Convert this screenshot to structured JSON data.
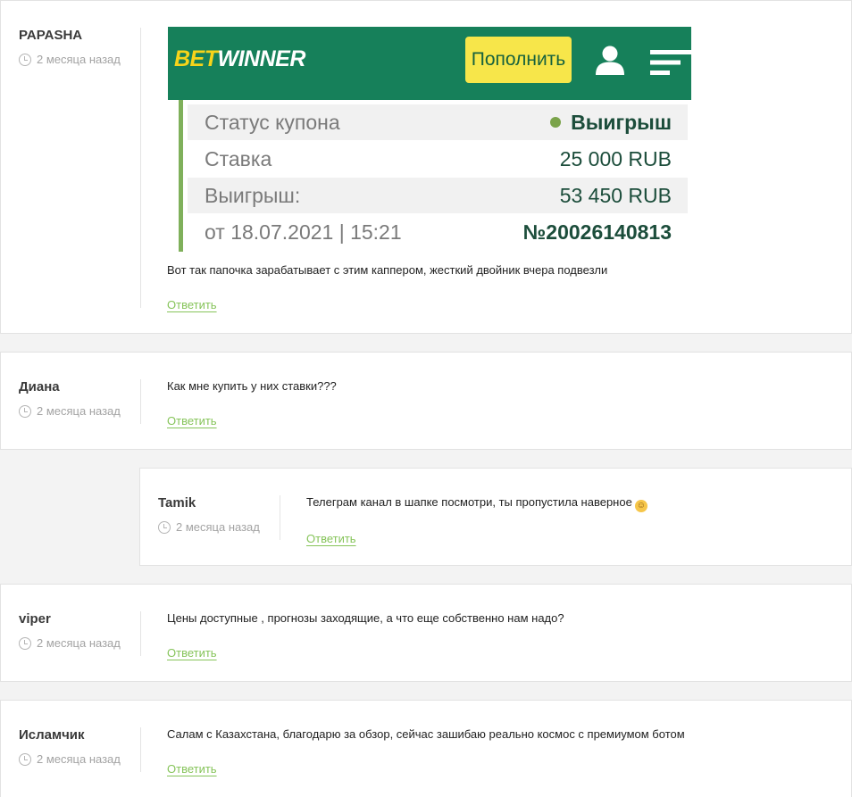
{
  "comments": [
    {
      "author": "PAPASHA",
      "time": "2 месяца назад",
      "text": "Вот так папочка зарабатывает с этим каппером, жесткий двойник вчера подвезли",
      "reply": "Ответить",
      "screenshot": {
        "logo_bet": "BET",
        "logo_winner": "WINNER",
        "deposit_button": "Пополнить",
        "rows": [
          {
            "label": "Статус купона",
            "value": "Выигрыш"
          },
          {
            "label": "Ставка",
            "value": "25 000 RUB"
          },
          {
            "label": "Выигрыш:",
            "value": "53 450 RUB"
          },
          {
            "label": "от 18.07.2021 | 15:21",
            "value_prefix": "№",
            "value": "20026140813"
          }
        ],
        "colors": {
          "header": "#16805a",
          "button": "#f7e64a",
          "status_dot": "#7aa34a"
        }
      }
    },
    {
      "author": "Диана",
      "time": "2 месяца назад",
      "text": "Как мне купить у них ставки???",
      "reply": "Ответить"
    },
    {
      "author": "Tamik",
      "time": "2 месяца назад",
      "text": "Телеграм канал в шапке посмотри, ты пропустила наверное",
      "reply": "Ответить",
      "emoji": "relieved-face"
    },
    {
      "author": "viper",
      "time": "2 месяца назад",
      "text": "Цены доступные , прогнозы заходящие, а что еще собственно нам надо?",
      "reply": "Ответить"
    },
    {
      "author": "Исламчик",
      "time": "2 месяца назад",
      "text": "Салам с Казахстана, благодарю за обзор, сейчас зашибаю реально космос с премиумом ботом",
      "reply": "Ответить"
    }
  ],
  "colors": {
    "accent": "#86c45a",
    "background": "#f3f3f3"
  }
}
